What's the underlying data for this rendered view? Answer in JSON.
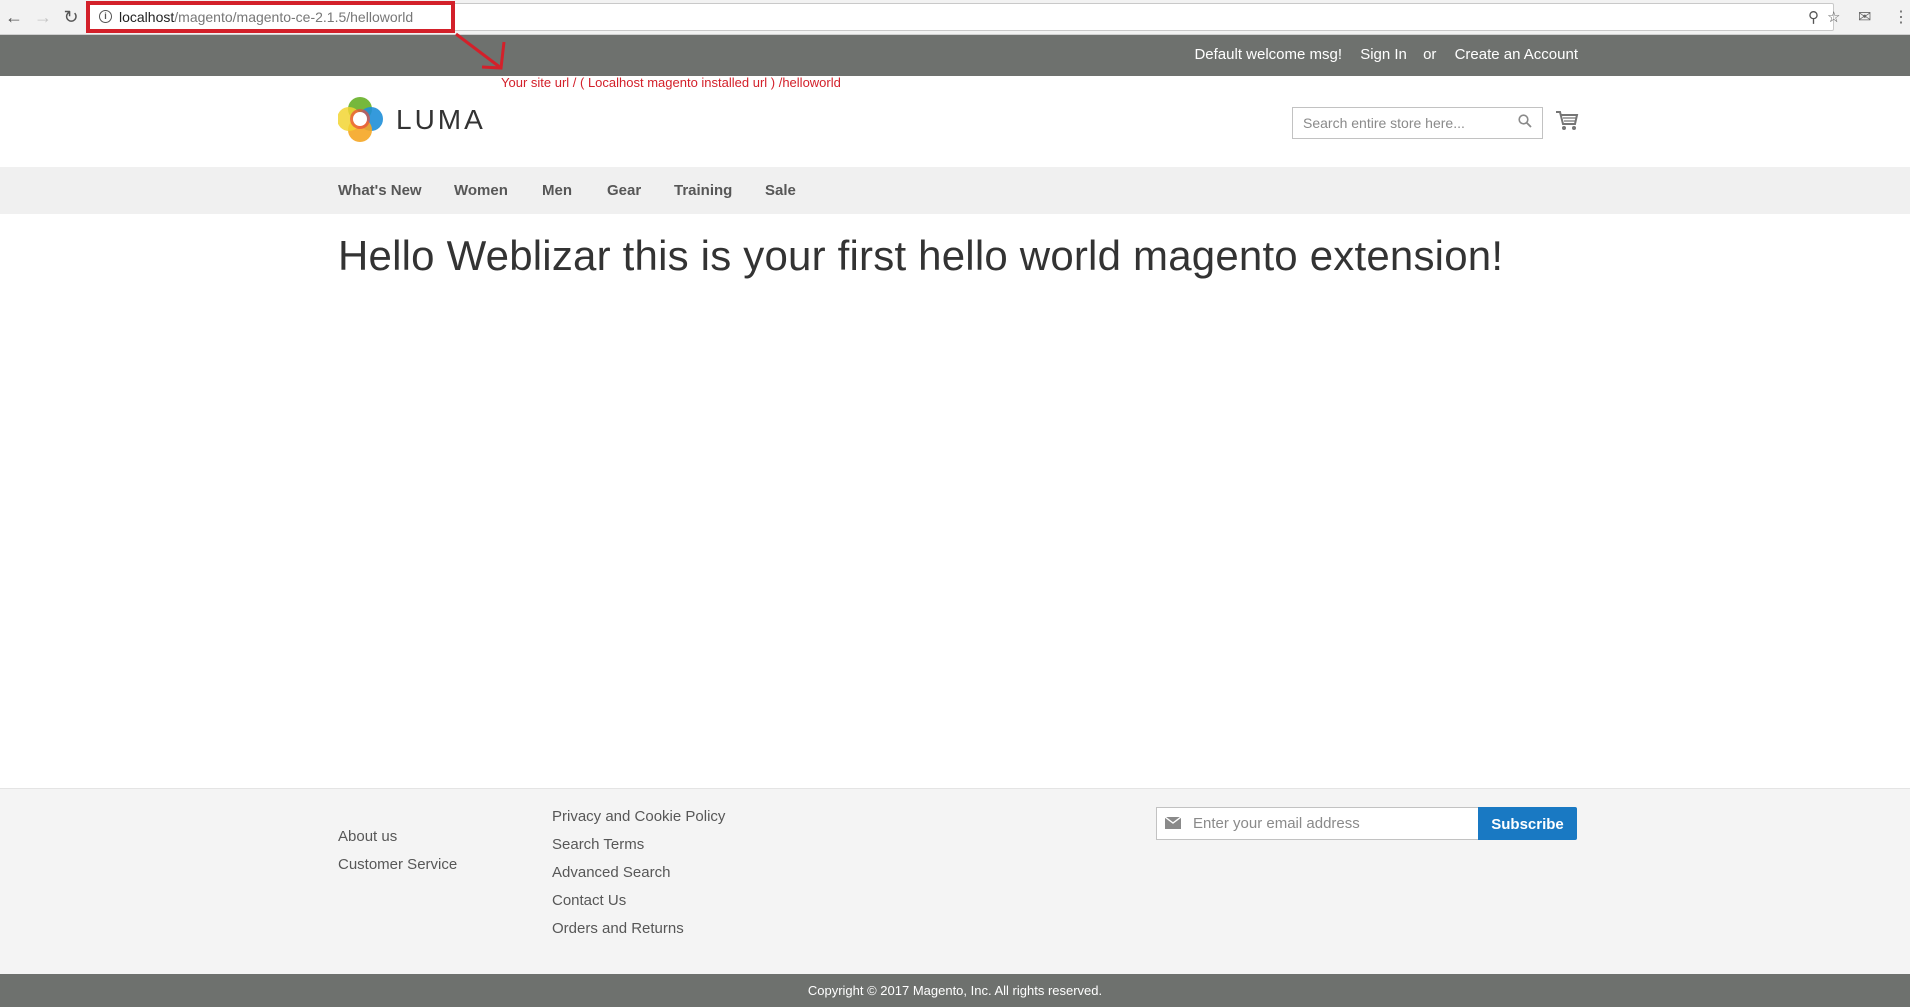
{
  "browser": {
    "url_host": "localhost",
    "url_path": "/magento/magento-ce-2.1.5/helloworld"
  },
  "annotation": {
    "text": "Your site url / ( Localhost magento installed url ) /helloworld"
  },
  "panel": {
    "welcome": "Default welcome msg!",
    "sign_in": "Sign In",
    "or": "or",
    "create_account": "Create an Account"
  },
  "header": {
    "logo_text": "LUMA",
    "search_placeholder": "Search entire store here..."
  },
  "nav": {
    "items": [
      {
        "label": "What's New"
      },
      {
        "label": "Women"
      },
      {
        "label": "Men"
      },
      {
        "label": "Gear"
      },
      {
        "label": "Training"
      },
      {
        "label": "Sale"
      }
    ]
  },
  "main": {
    "title": "Hello Weblizar this is your first hello world magento extension!"
  },
  "footer": {
    "col1": [
      "About us",
      "Customer Service"
    ],
    "col2": [
      "Privacy and Cookie Policy",
      "Search Terms",
      "Advanced Search",
      "Contact Us",
      "Orders and Returns"
    ],
    "newsletter_placeholder": "Enter your email address",
    "subscribe_label": "Subscribe",
    "copyright": "Copyright © 2017 Magento, Inc. All rights reserved."
  },
  "colors": {
    "accent": "#1979c3",
    "panel": "#6e716e",
    "annotation": "#d3202a"
  }
}
